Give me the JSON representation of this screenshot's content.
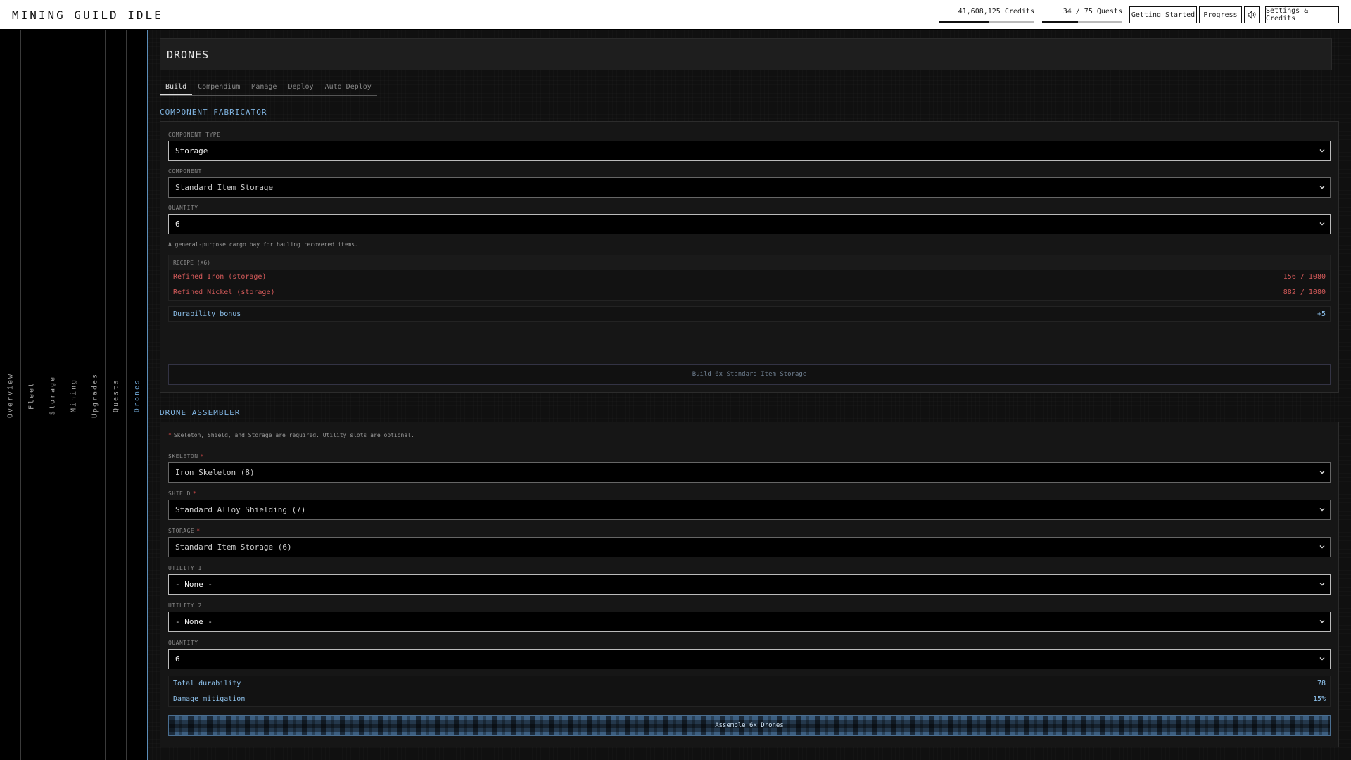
{
  "app": {
    "title": "MINING GUILD IDLE"
  },
  "header": {
    "credits": {
      "text": "41,608,125 Credits",
      "fill": 0.52
    },
    "quests": {
      "text": "34 / 75 Quests",
      "fill": 0.45
    },
    "buttons": {
      "getting_started": "Getting Started",
      "progress": "Progress",
      "settings": "Settings & Credits"
    }
  },
  "sidebar": {
    "items": [
      "Overview",
      "Fleet",
      "Storage",
      "Mining",
      "Upgrades",
      "Quests",
      "Drones"
    ],
    "active": "Drones"
  },
  "page": {
    "title": "DRONES",
    "tabs": [
      "Build",
      "Compendium",
      "Manage",
      "Deploy",
      "Auto Deploy"
    ],
    "active_tab": "Build"
  },
  "fabricator": {
    "title": "COMPONENT FABRICATOR",
    "component_type_label": "COMPONENT TYPE",
    "component_type_value": "Storage",
    "component_label": "COMPONENT",
    "component_value": "Standard Item Storage",
    "quantity_label": "QUANTITY",
    "quantity_value": "6",
    "description": "A general-purpose cargo bay for hauling recovered items.",
    "recipe_header": "RECIPE (X6)",
    "recipe": [
      {
        "name": "Refined Iron (storage)",
        "amount": "156 / 1080"
      },
      {
        "name": "Refined Nickel (storage)",
        "amount": "882 / 1080"
      }
    ],
    "bonus_label": "Durability bonus",
    "bonus_value": "+5",
    "build_button": "Build 6x Standard Item Storage"
  },
  "assembler": {
    "title": "DRONE ASSEMBLER",
    "required_mark": "*",
    "note": "Skeleton, Shield, and Storage are required. Utility slots are optional.",
    "skeleton_label": "SKELETON",
    "skeleton_value": "Iron Skeleton (8)",
    "shield_label": "SHIELD",
    "shield_value": "Standard Alloy Shielding (7)",
    "storage_label": "STORAGE",
    "storage_value": "Standard Item Storage (6)",
    "utility1_label": "UTILITY 1",
    "utility1_value": "- None -",
    "utility2_label": "UTILITY 2",
    "utility2_value": "- None -",
    "quantity_label": "QUANTITY",
    "quantity_value": "6",
    "stats": [
      {
        "label": "Total durability",
        "value": "78"
      },
      {
        "label": "Damage mitigation",
        "value": "15%"
      }
    ],
    "assemble_button": "Assemble 6x Drones"
  },
  "colors": {
    "accent": "#7fb3e0",
    "danger": "#d45a5a",
    "background": "#111111"
  }
}
